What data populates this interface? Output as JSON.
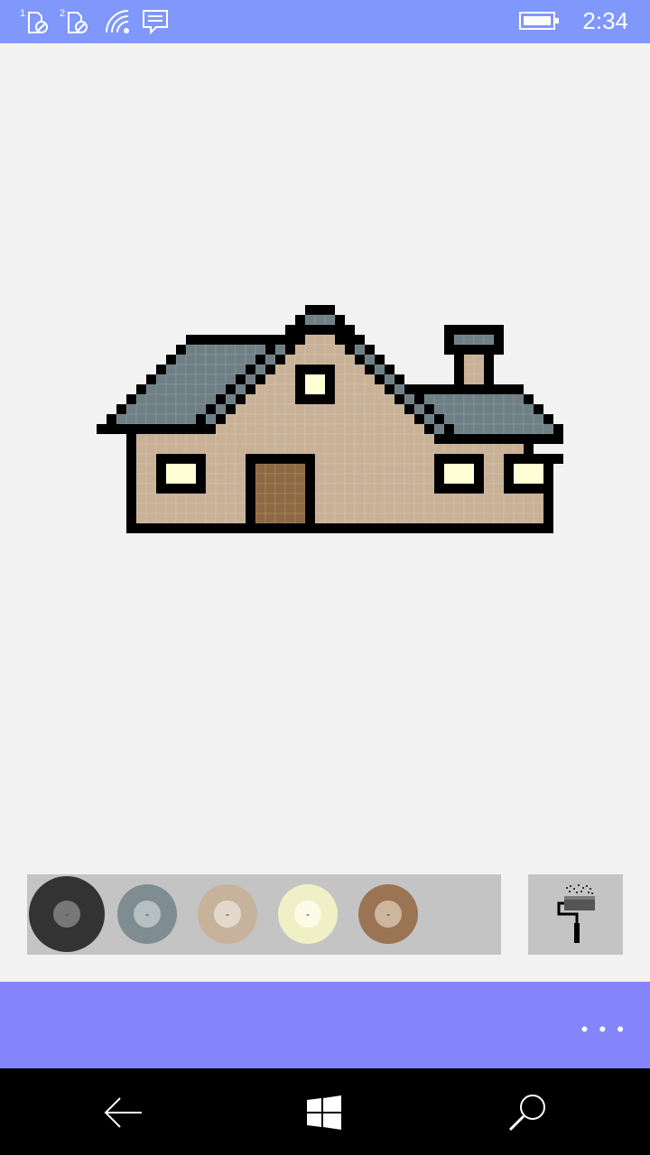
{
  "status_bar": {
    "time": "2:34",
    "icons": [
      "sim1-no-signal-icon",
      "sim2-no-signal-icon",
      "wifi-icon",
      "message-icon",
      "battery-icon"
    ],
    "sim1_label": "1",
    "sim2_label": "2",
    "background": "#8097fb"
  },
  "palette": {
    "colors": [
      {
        "name": "black",
        "outer": "#333333",
        "inner": "#777777",
        "label": "-",
        "selected": true
      },
      {
        "name": "slate",
        "outer": "#7f8c91",
        "inner": "#b6c0c3",
        "label": "-",
        "selected": false
      },
      {
        "name": "tan",
        "outer": "#c7b29b",
        "inner": "#e4d8cc",
        "label": "-",
        "selected": false
      },
      {
        "name": "cream",
        "outer": "#f0f0c6",
        "inner": "#fbfbe8",
        "label": "-",
        "selected": false
      },
      {
        "name": "brown",
        "outer": "#9b7553",
        "inner": "#cdb59e",
        "label": "-",
        "selected": false
      }
    ]
  },
  "tool": {
    "icon": "paint-roller-icon"
  },
  "app_bar": {
    "more_label": "• • •",
    "background": "#8485fb"
  },
  "nav_bar": {
    "icons": [
      "back-arrow-icon",
      "windows-start-icon",
      "search-icon"
    ]
  },
  "pixel_art": {
    "colors": {
      "K": "#000000",
      "R": "#6f7f86",
      "W": "#c9b198",
      "Y": "#ffffd4",
      "D": "#8e6a42"
    },
    "background": "#f2f2f2",
    "rows": [
      "................................................",
      "......................KKK.......................",
      ".....................KRRRK......................",
      "....................KKKKKKK.........KKKKKK......",
      "..........KKKKKKKKKKKKWWWKKK........KRRRRK......",
      ".........KRRRRRRRRKRKWWWWWKRK.......KKKKKK......",
      "........KRRRRRRRRKRKWWWWWWWKRK.......KWWK.......",
      ".......KRRRRRRRRKRKWWKKKKWWWKRK......KWWK.......",
      "......KRRRRRRRRKRKWWWKYYKWWWWKRK.....KWWK.......",
      ".....KRRRRRRRRKRKWWWWKYYKWWWWWKRKKKKKKKKKKKK....",
      "....KRRRRRRRRKRKWWWWWKKKKWWWWWWKRKRRRRRRRRRRK...",
      "...KRRRRRRRRKRKWWWWWWWWWWWWWWWWWKRKRRRRRRRRRRK..",
      "..KRRRRRRRRKRKWWWWWWWWWWWWWWWWWWWKRKRRRRRRRRRRK.",
      ".KKKKKKKKKKKKWWWWWWWWWWWWWWWWWWWWWKRKRRRRRRRRRRK",
      "....KWWWWWWWWWWWWWWWWWWWWWWWWWWWWWWKKKKKKKKKKKKK",
      "....KWWWWWWWWWWWWWWWWWWWWWWWWWWWWWWWWWWWWWWWK...",
      "....KWWKKKKKWWWWKKKKKKKWWWWWWWWWWWWKKKKKWWKKKKKK",
      "....KWWKYYYKWWWWKDDDDDKWWWWWWWWWWWWKYYYKWWKYYYK.",
      "....KWWKYYYKWWWWKDDDDDKWWWWWWWWWWWWKYYYKWWKYYYK.",
      "....KWWKKKKKWWWWKDDDDDKWWWWWWWWWWWWKKKKKWWKKKKK.",
      "....KWWWWWWWWWWWKDDDDDKWWWWWWWWWWWWWWWWWWWWWWWK.",
      "....KWWWWWWWWWWWKDDDDDKWWWWWWWWWWWWWWWWWWWWWWWK.",
      "....KWWWWWWWWWWWKDDDDDKWWWWWWWWWWWWWWWWWWWWWWWK.",
      "....KKKKKKKKKKKKKKKKKKKKKKKKKKKKKKKKKKKKKKKKKKK."
    ]
  }
}
